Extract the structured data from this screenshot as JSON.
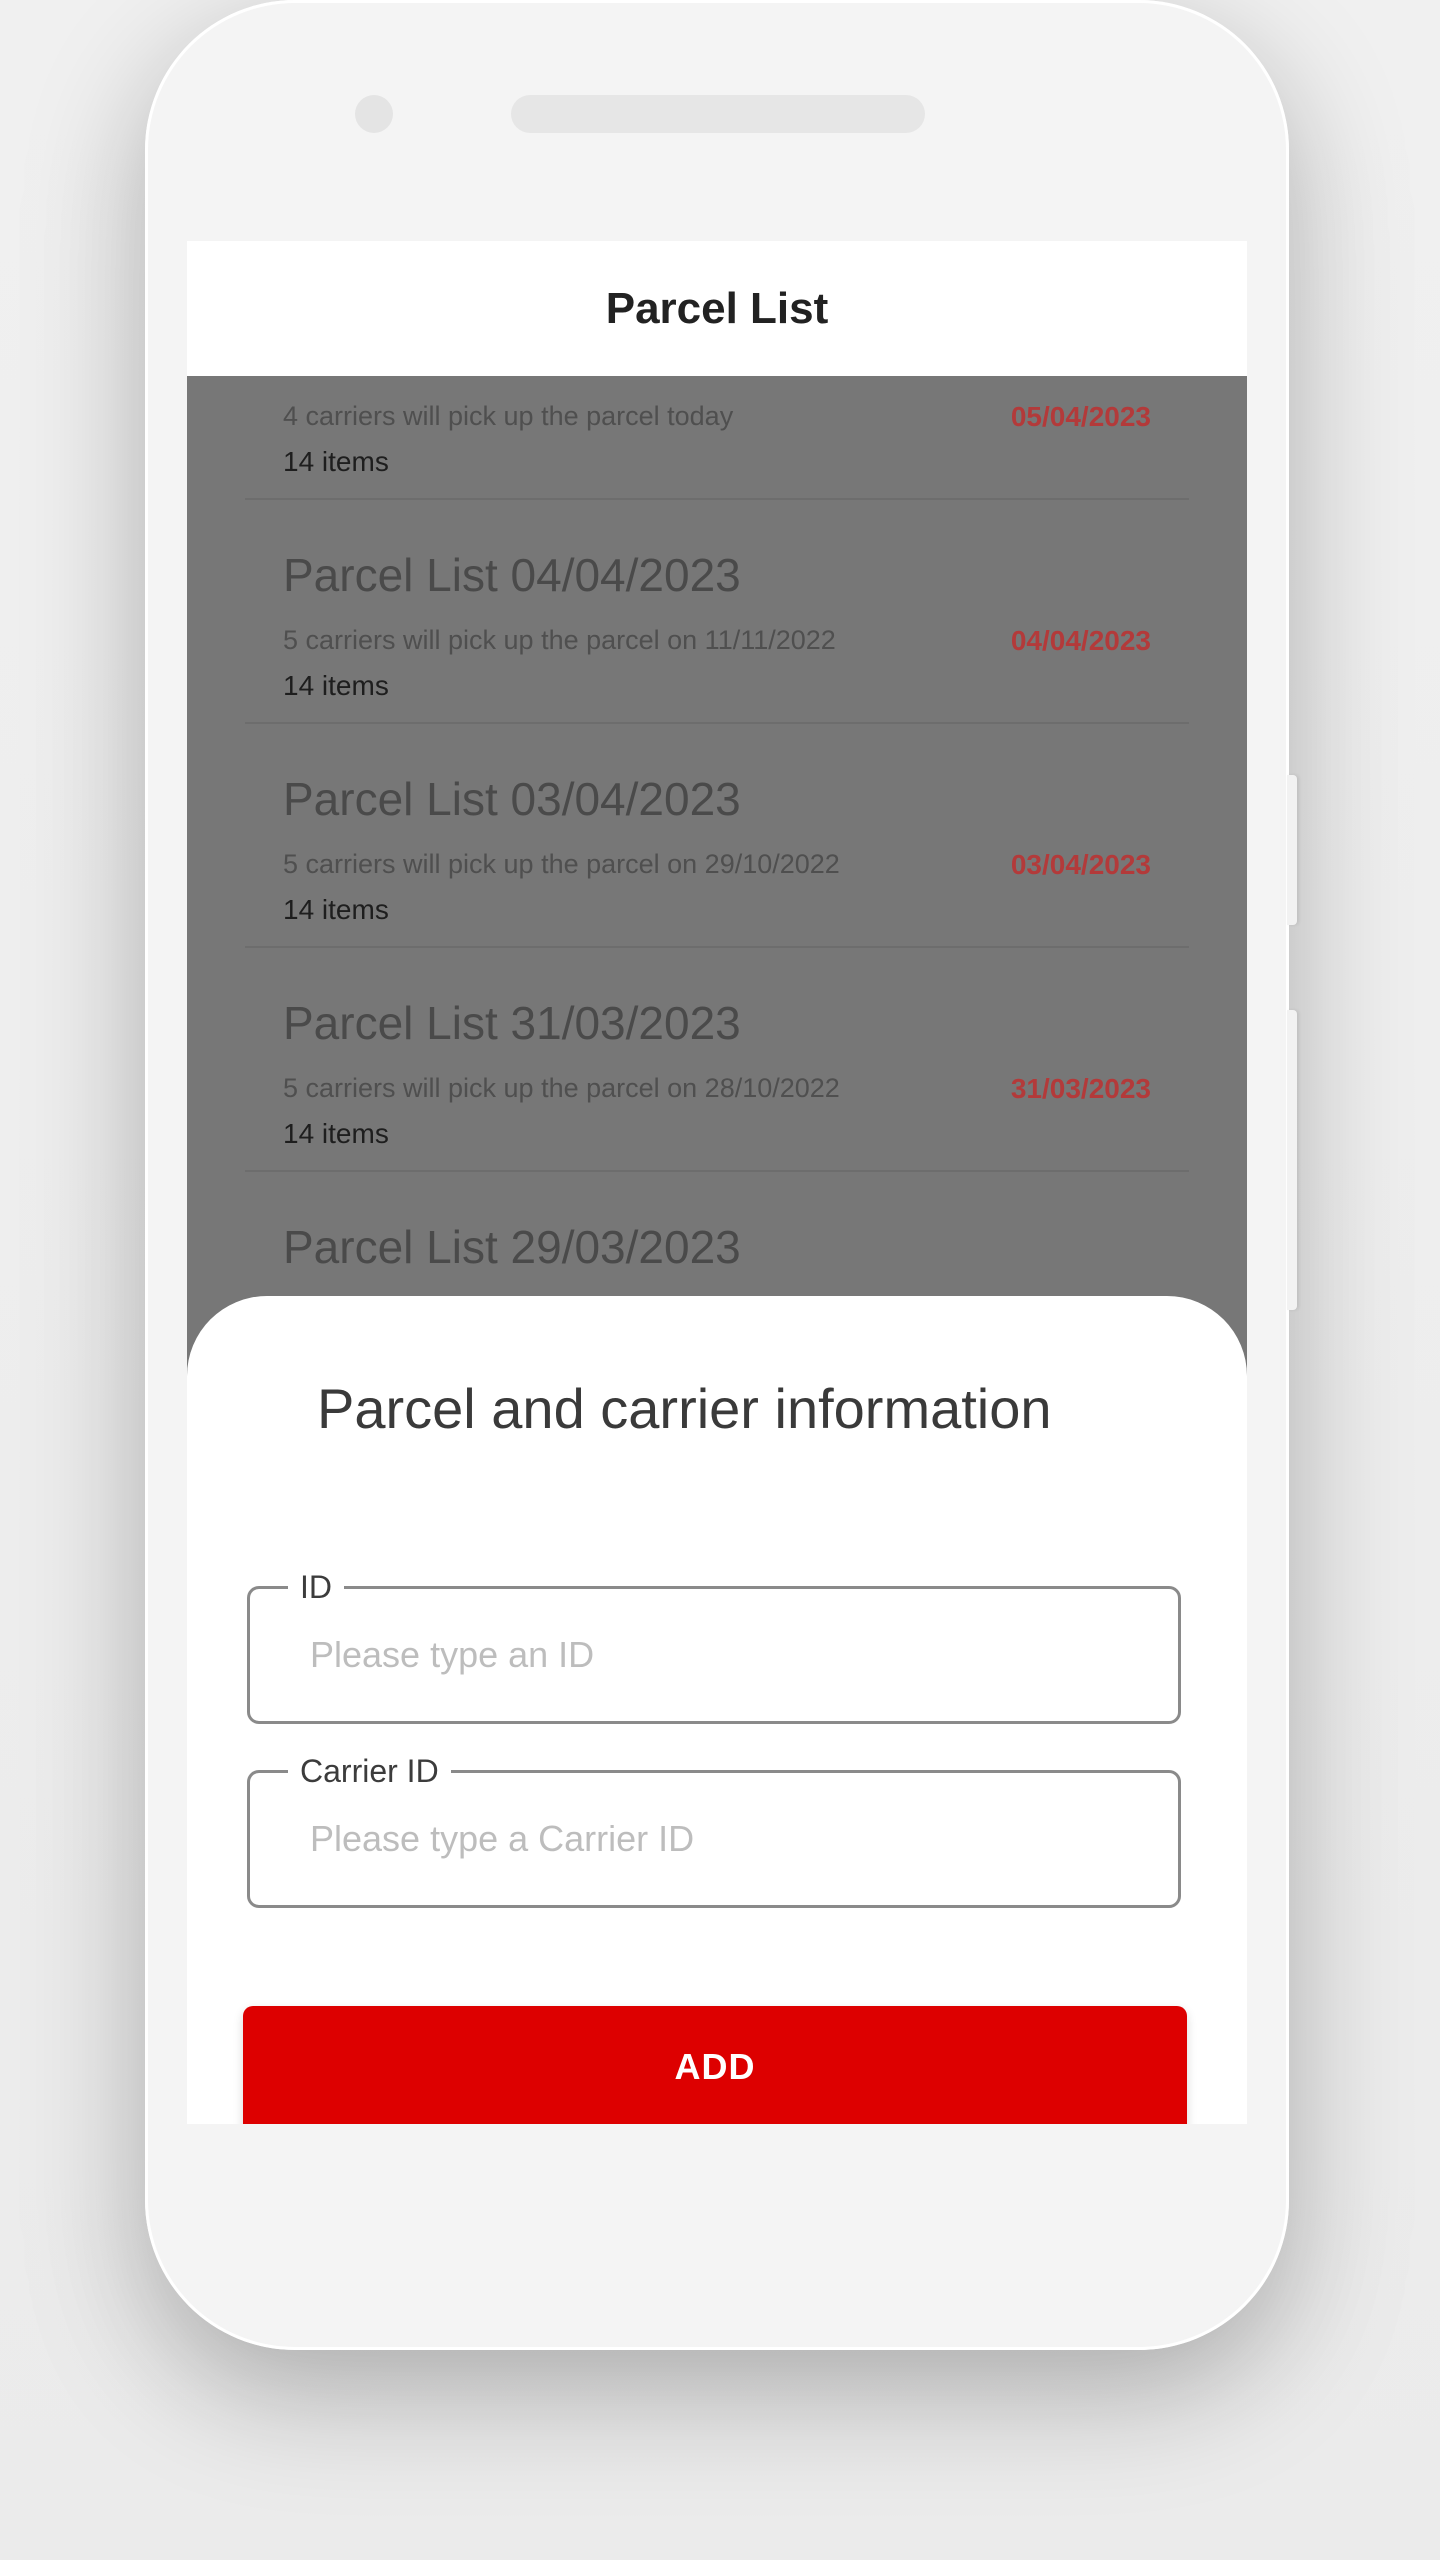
{
  "header": {
    "title": "Parcel List"
  },
  "parcel_list": [
    {
      "title": "",
      "subtitle": "4 carriers will pick up the parcel today",
      "date": "05/04/2023",
      "count": "14 items"
    },
    {
      "title": "Parcel List 04/04/2023",
      "subtitle": "5 carriers will pick up the parcel on 11/11/2022",
      "date": "04/04/2023",
      "count": "14 items"
    },
    {
      "title": "Parcel List 03/04/2023",
      "subtitle": "5 carriers will pick up the parcel on 29/10/2022",
      "date": "03/04/2023",
      "count": "14 items"
    },
    {
      "title": "Parcel List 31/03/2023",
      "subtitle": "5 carriers will pick up the parcel on 28/10/2022",
      "date": "31/03/2023",
      "count": "14 items"
    },
    {
      "title": "Parcel List 29/03/2023",
      "subtitle": "",
      "date": "",
      "count": ""
    }
  ],
  "sheet": {
    "title": "Parcel and carrier information",
    "id_field": {
      "label": "ID",
      "placeholder": "Please type an ID"
    },
    "carrier_field": {
      "label": "Carrier ID",
      "placeholder": "Please type a Carrier ID"
    },
    "add_label": "ADD"
  },
  "colors": {
    "accent": "#dd0000",
    "date_text": "#b33a3a",
    "overlay": "#777777"
  }
}
